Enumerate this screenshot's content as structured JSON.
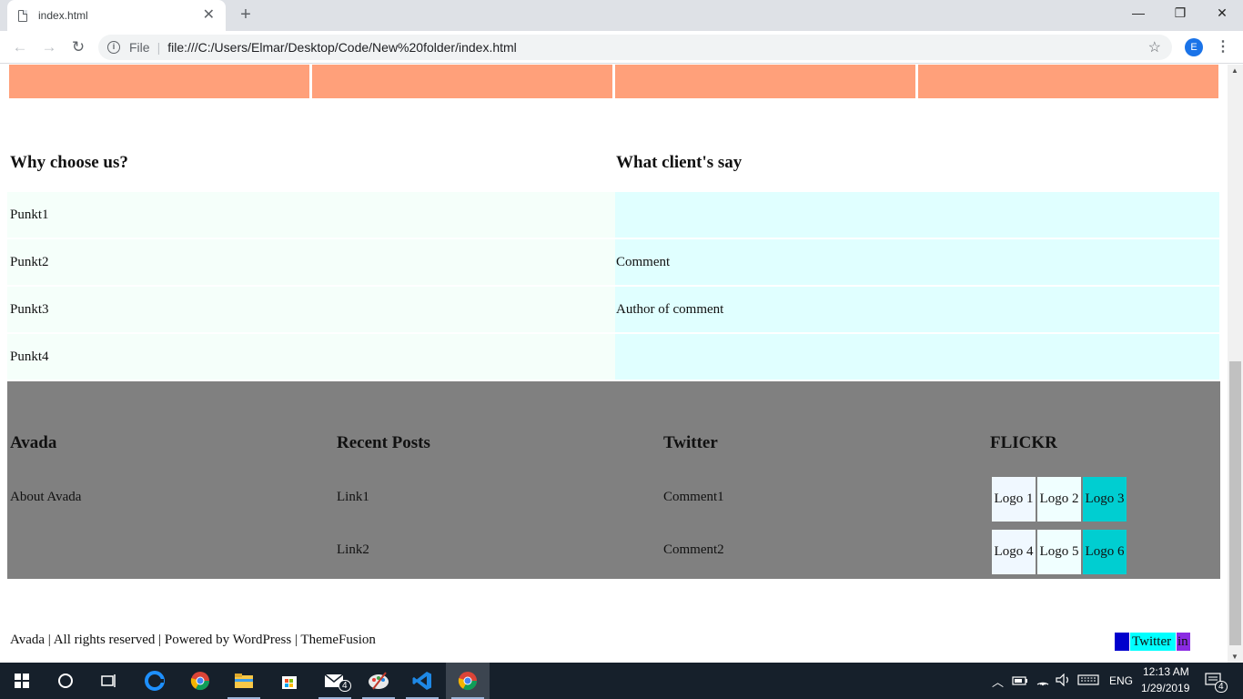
{
  "browser": {
    "tab_title": "index.html",
    "tab_close": "✕",
    "new_tab": "+",
    "controls": {
      "minimize": "—",
      "restore": "❐",
      "close": "✕"
    },
    "nav": {
      "back": "←",
      "forward": "→",
      "reload": "↻"
    },
    "omnibox": {
      "info": "i",
      "scheme_label": "File",
      "separator": "|",
      "url": "file:///C:/Users/Elmar/Desktop/Code/New%20folder/index.html"
    },
    "bookmark": "☆",
    "profile_initial": "E",
    "menu": "⋮"
  },
  "page": {
    "why_title": "Why choose us?",
    "why_items": [
      "Punkt1",
      "Punkt2",
      "Punkt3",
      "Punkt4"
    ],
    "clients_title": "What client's say",
    "client_rows": [
      "",
      "Comment",
      "Author of comment",
      ""
    ],
    "footer": {
      "col1": {
        "title": "Avada",
        "items": [
          "About Avada"
        ]
      },
      "col2": {
        "title": "Recent Posts",
        "items": [
          "Link1",
          "Link2"
        ]
      },
      "col3": {
        "title": "Twitter",
        "items": [
          "Comment1",
          "Comment2"
        ]
      },
      "col4": {
        "title": "FLICKR",
        "logos": [
          "Logo 1",
          "Logo 2",
          "Logo 3",
          "Logo 4",
          "Logo 5",
          "Logo 6"
        ]
      }
    },
    "copyright": "Avada | All rights reserved | Powered by WordPress | ThemeFusion",
    "social": [
      "fb",
      "Twitter",
      "in"
    ],
    "colors": {
      "top_band": "#ffa07a",
      "why_bg": "#f5fffa",
      "clients_bg": "#e0ffff",
      "footer_bg": "#808080",
      "social_fb": "#0000cd",
      "social_twitter": "#00ffff",
      "social_in": "#8a2be2"
    }
  },
  "taskbar": {
    "language": "ENG",
    "time": "12:13 AM",
    "date": "1/29/2019",
    "mail_badge": "4",
    "notifications": "4",
    "apps": [
      "start-icon",
      "search-icon",
      "task-view-icon",
      "edge-icon",
      "chrome-icon",
      "file-explorer-icon",
      "store-icon",
      "mail-icon",
      "paint-icon",
      "vscode-icon",
      "chrome-active-icon"
    ]
  }
}
